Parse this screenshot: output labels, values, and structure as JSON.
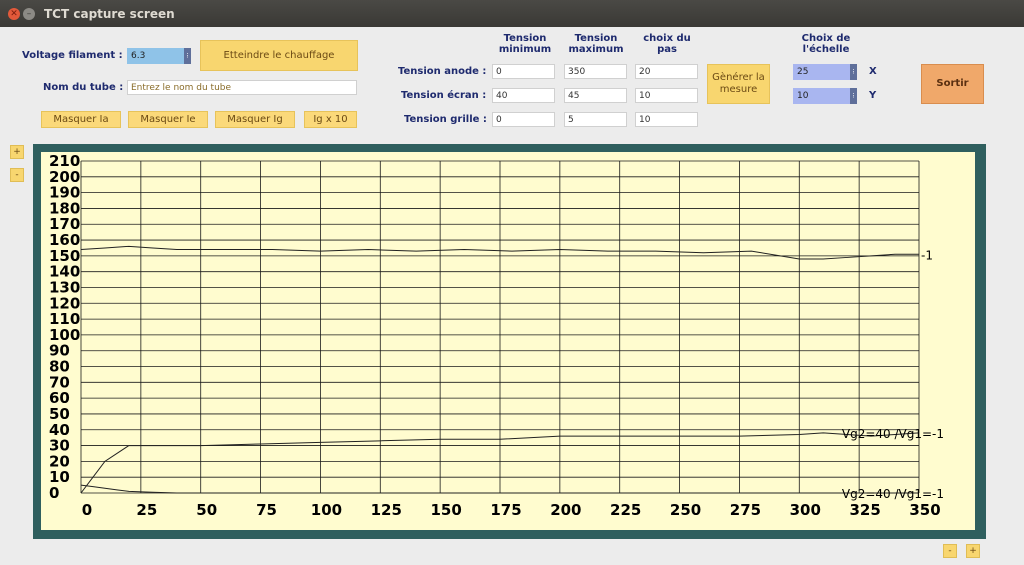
{
  "window": {
    "title": "TCT capture screen"
  },
  "controls": {
    "filament_label": "Voltage filament :",
    "filament_value": "6.3",
    "heat_button": "Etteindre le chauffage",
    "tube_label": "Nom du tube :",
    "tube_placeholder": "Entrez le nom du tube",
    "hide_ia": "Masquer Ia",
    "hide_ie": "Masquer Ie",
    "hide_ig": "Masquer Ig",
    "ig_x10": "Ig x 10"
  },
  "tension": {
    "col_min": [
      "Tension",
      "minimum"
    ],
    "col_max": [
      "Tension",
      "maximum"
    ],
    "col_pas": [
      "choix du",
      "pas"
    ],
    "rows": [
      {
        "label": "Tension anode :",
        "min": "0",
        "max": "350",
        "pas": "20"
      },
      {
        "label": "Tension écran :",
        "min": "40",
        "max": "45",
        "pas": "10"
      },
      {
        "label": "Tension grille :",
        "min": "0",
        "max": "5",
        "pas": "10"
      }
    ],
    "generate_button": [
      "Gènérer la",
      "mesure"
    ]
  },
  "scale": {
    "header": [
      "Choix de",
      "l'échelle"
    ],
    "x_value": "25",
    "x_label": "X",
    "y_value": "10",
    "y_label": "Y"
  },
  "exit_button": "Sortir",
  "zoom": {
    "plus": "+",
    "minus": "-"
  },
  "chart_data": {
    "type": "line",
    "xlim": [
      0,
      350
    ],
    "ylim": [
      0,
      210
    ],
    "x_ticks": [
      0,
      25,
      50,
      75,
      100,
      125,
      150,
      175,
      200,
      225,
      250,
      275,
      300,
      325,
      350
    ],
    "y_ticks": [
      0,
      10,
      20,
      30,
      40,
      50,
      60,
      70,
      80,
      90,
      100,
      110,
      120,
      130,
      140,
      150,
      160,
      170,
      180,
      190,
      200,
      210
    ],
    "grid": true,
    "series": [
      {
        "name": "-1",
        "x": [
          0,
          10,
          20,
          30,
          40,
          60,
          80,
          100,
          120,
          140,
          160,
          180,
          200,
          220,
          240,
          260,
          280,
          300,
          310,
          320,
          330,
          340,
          350
        ],
        "y": [
          154,
          155,
          156,
          155,
          154,
          154,
          154,
          153,
          154,
          153,
          154,
          153,
          154,
          153,
          153,
          152,
          153,
          148,
          148,
          149,
          150,
          151,
          151
        ]
      },
      {
        "name": "Vg2=40  /Vg1=-1",
        "x": [
          0,
          5,
          10,
          15,
          20,
          50,
          75,
          100,
          125,
          150,
          175,
          200,
          225,
          250,
          275,
          300,
          310,
          320,
          330,
          340,
          350
        ],
        "y": [
          0,
          10,
          20,
          25,
          30,
          30,
          31,
          32,
          33,
          34,
          34,
          36,
          36,
          36,
          36,
          37,
          38,
          37,
          36,
          37,
          38
        ]
      },
      {
        "name": "Vg2=40  /Vg1=-1",
        "x": [
          0,
          5,
          10,
          15,
          20,
          30,
          40,
          50,
          100,
          150,
          200,
          250,
          300,
          350
        ],
        "y": [
          5,
          4,
          3,
          2,
          1,
          0.5,
          0,
          0,
          0,
          0,
          0,
          0,
          0,
          0
        ]
      }
    ]
  }
}
